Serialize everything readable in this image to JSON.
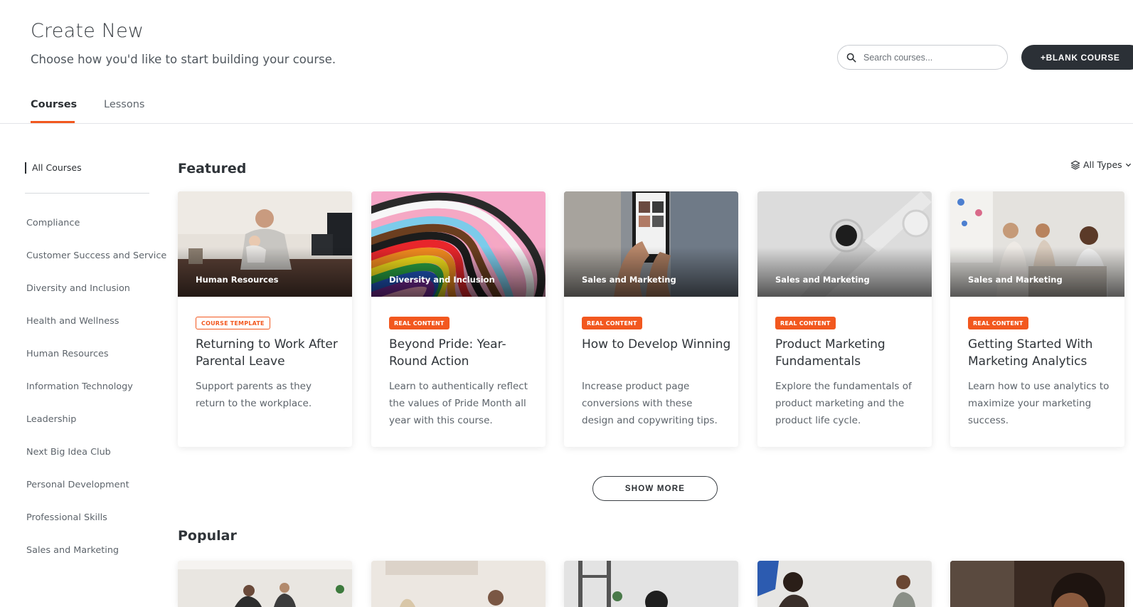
{
  "header": {
    "title": "Create New",
    "subtitle": "Choose how you'd like to start building your course.",
    "search_placeholder": "Search courses...",
    "blank_course_label": "+BLANK COURSE"
  },
  "tabs": [
    {
      "label": "Courses",
      "active": true
    },
    {
      "label": "Lessons",
      "active": false
    }
  ],
  "sidebar": {
    "active_label": "All Courses",
    "items": [
      "Compliance",
      "Customer Success and Service",
      "Diversity and Inclusion",
      "Health and Wellness",
      "Human Resources",
      "Information Technology",
      "Leadership",
      "Next Big Idea Club",
      "Personal Development",
      "Professional Skills",
      "Sales and Marketing"
    ]
  },
  "featured": {
    "title": "Featured",
    "filter_label": "All Types",
    "cards": [
      {
        "category": "Human Resources",
        "badge": "COURSE TEMPLATE",
        "title": "Returning to Work After Parental Leave",
        "description": "Support parents as they return to the workplace."
      },
      {
        "category": "Diversity and Inclusion",
        "badge": "REAL CONTENT",
        "title": "Beyond Pride: Year-Round Action",
        "description": "Learn to authentically reflect the values of Pride Month all year with this course."
      },
      {
        "category": "Sales and Marketing",
        "badge": "REAL CONTENT",
        "title": "How to Develop Winning Product Page...",
        "description": "Increase product page conversions with these design and copywriting tips."
      },
      {
        "category": "Sales and Marketing",
        "badge": "REAL CONTENT",
        "title": "Product Marketing Fundamentals",
        "description": "Explore the fundamentals of product marketing and the product life cycle."
      },
      {
        "category": "Sales and Marketing",
        "badge": "REAL CONTENT",
        "title": "Getting Started With Marketing Analytics",
        "description": "Learn how to use analytics to maximize your marketing success."
      }
    ],
    "show_more_label": "SHOW MORE"
  },
  "popular": {
    "title": "Popular"
  },
  "colors": {
    "accent": "#f2581f",
    "dark_button": "#2b3036"
  }
}
